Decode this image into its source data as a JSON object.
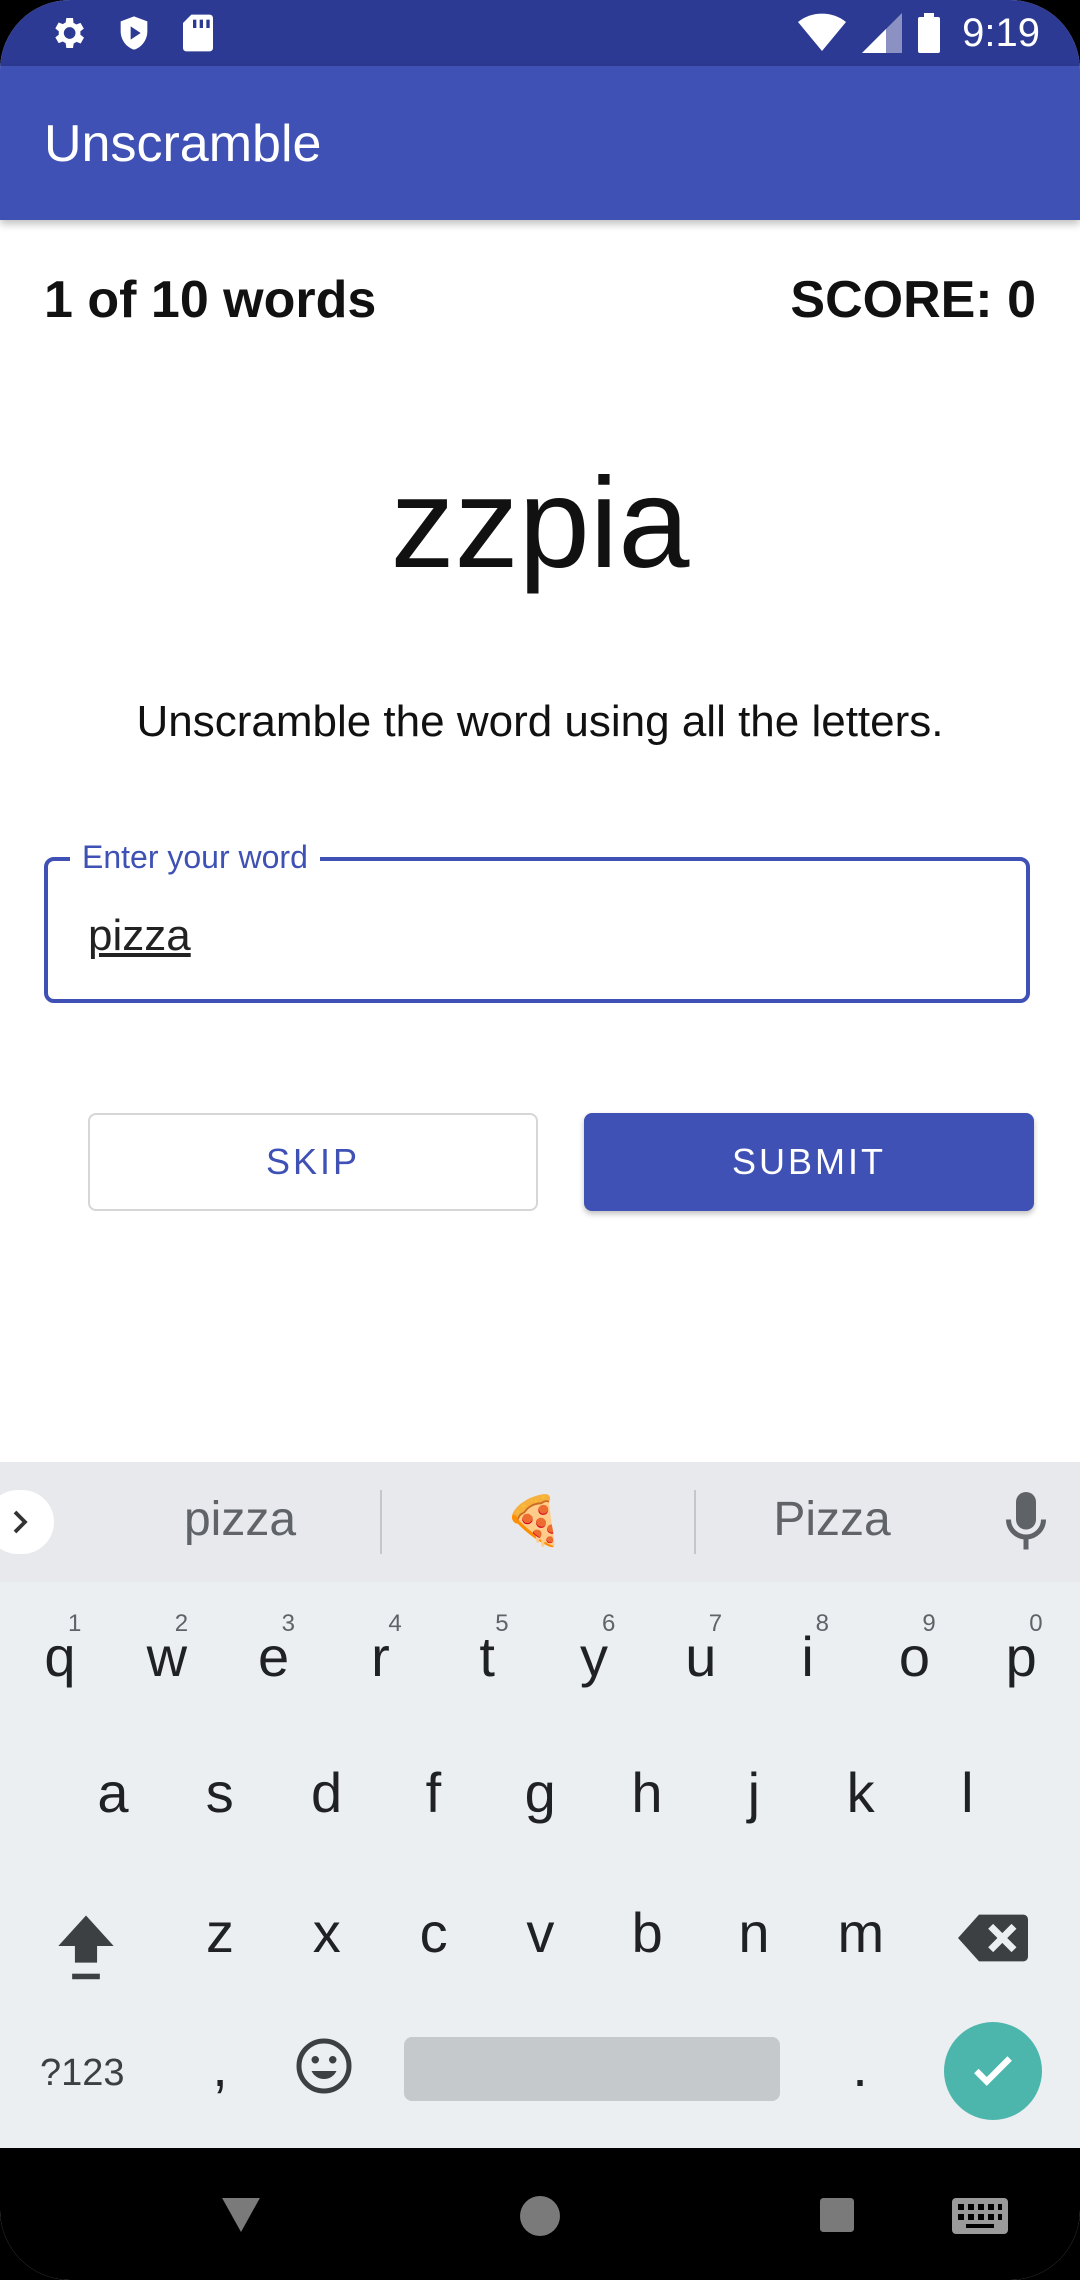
{
  "status_bar": {
    "time": "9:19",
    "left_icons": [
      "gear-icon",
      "shield-icon",
      "sd-card-icon"
    ],
    "right_icons": [
      "wifi-icon",
      "signal-icon",
      "battery-icon"
    ]
  },
  "app_bar": {
    "title": "Unscramble"
  },
  "game": {
    "word_count": "1 of 10 words",
    "score": "SCORE: 0",
    "scrambled_word": "zzpia",
    "instructions": "Unscramble the word using all the letters.",
    "input": {
      "label": "Enter your word",
      "value": "pizza"
    },
    "skip_label": "SKIP",
    "submit_label": "SUBMIT"
  },
  "keyboard": {
    "suggestions": [
      "pizza",
      "🍕",
      "Pizza"
    ],
    "row1": [
      "q",
      "w",
      "e",
      "r",
      "t",
      "y",
      "u",
      "i",
      "o",
      "p"
    ],
    "row1_hints": [
      "1",
      "2",
      "3",
      "4",
      "5",
      "6",
      "7",
      "8",
      "9",
      "0"
    ],
    "row2": [
      "a",
      "s",
      "d",
      "f",
      "g",
      "h",
      "j",
      "k",
      "l"
    ],
    "row3": [
      "z",
      "x",
      "c",
      "v",
      "b",
      "n",
      "m"
    ],
    "symbols_label": "?123",
    "comma": ",",
    "period": "."
  },
  "colors": {
    "primary": "#3f51b5",
    "status_bar": "#2c3a93",
    "enter_key": "#4db6ac"
  }
}
